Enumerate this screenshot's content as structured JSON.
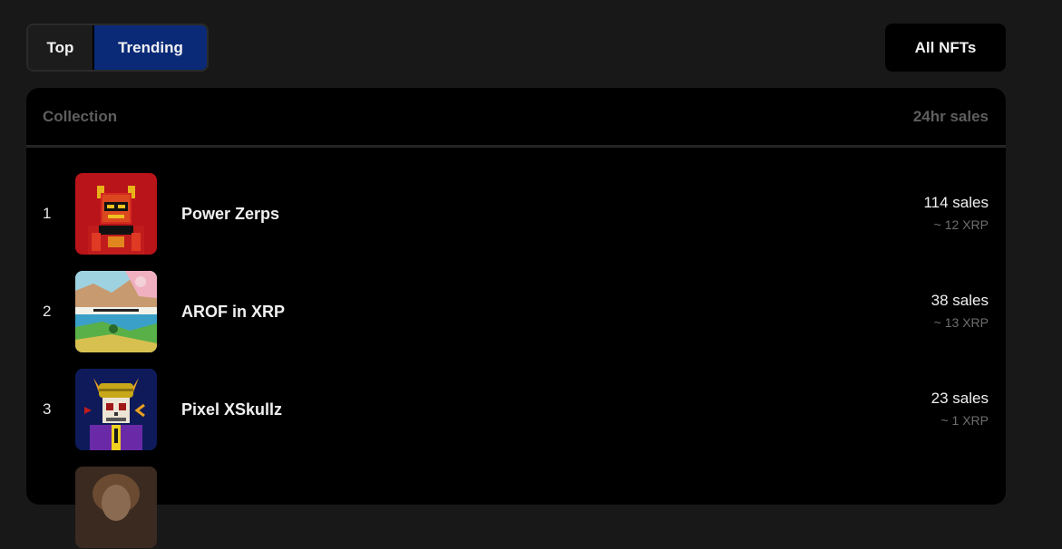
{
  "tabs": {
    "top_label": "Top",
    "trending_label": "Trending",
    "active": "Trending"
  },
  "all_nfts_label": "All NFTs",
  "table": {
    "col_collection": "Collection",
    "col_sales": "24hr sales",
    "rows": [
      {
        "rank": "1",
        "name": "Power Zerps",
        "sales": "114 sales",
        "price": "~ 12 XRP",
        "thumb_icon": "red-pixel-robot-avatar"
      },
      {
        "rank": "2",
        "name": "AROF in XRP",
        "sales": "38 sales",
        "price": "~ 13 XRP",
        "thumb_icon": "landscape-collage-art"
      },
      {
        "rank": "3",
        "name": "Pixel XSkullz",
        "sales": "23 sales",
        "price": "~ 1 XRP",
        "thumb_icon": "pixel-skull-avatar"
      }
    ]
  },
  "colors": {
    "page_bg": "#181818",
    "panel_bg": "#000000",
    "active_tab": "#0a2a78",
    "muted_text": "#6e6e6e"
  }
}
